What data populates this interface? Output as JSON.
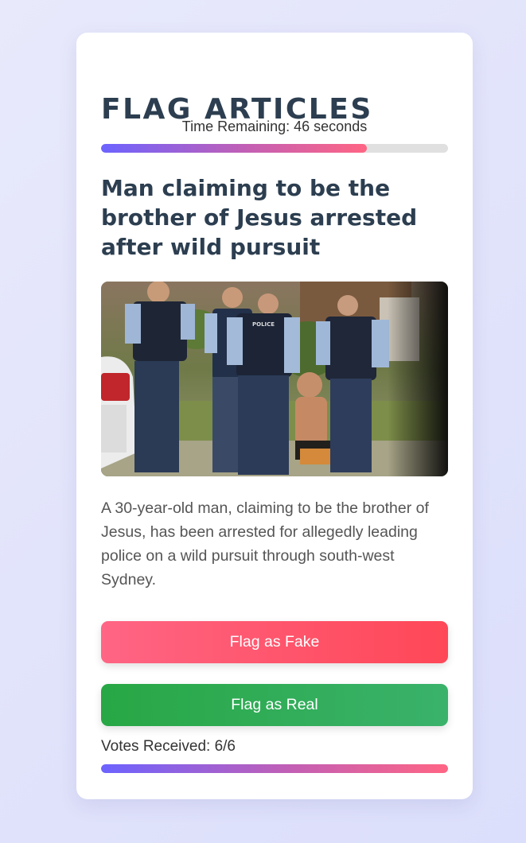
{
  "title": "FLAG ARTICLES",
  "timer": {
    "label": "Time Remaining: 46 seconds",
    "progress_fraction": 0.766
  },
  "article": {
    "headline": "Man claiming to be the brother of Jesus arrested after wild pursuit",
    "image_alt": "Police officers surrounding a shirtless man sitting on the ground",
    "image_badge_text": "POLICE",
    "description": "A 30-year-old man, claiming to be the brother of Jesus, has been arrested for allegedly leading police on a wild pursuit through south-west Sydney."
  },
  "buttons": {
    "fake_label": "Flag as Fake",
    "real_label": "Flag as Real"
  },
  "votes": {
    "label": "Votes Received: 6/6",
    "progress_fraction": 1.0
  },
  "colors": {
    "fake_button": "#ff4f6a",
    "real_button": "#2ea85a",
    "title": "#2c3e50",
    "progress_gradient_start": "#6c63ff",
    "progress_gradient_end": "#ff6584"
  }
}
